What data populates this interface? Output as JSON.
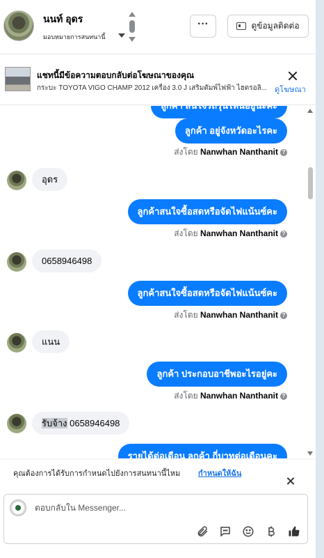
{
  "header": {
    "name": "นนท์ อุดร",
    "assign_label": "มอบหมายการสนทนานี้",
    "more_label": "···",
    "contact_label": "ดูข้อมูลติดต่อ"
  },
  "ad": {
    "title": "แชทนี้มีข้อความตอบกลับต่อโฆษณาของคุณ",
    "subtitle": "กระบะ TOYOTA VIGO CHAMP 2012 เครื่อง 3.0 J เสริมดัมพ์ไฟฟ้า ไฮดรอลิ...",
    "link": "ดูโฆษณา"
  },
  "messages": {
    "out_top_partial": "ลูกค้า สนใจรถรุ่นไหนอยู่นะคะ",
    "out_1": "ลูกค้า อยู่จังหวัดอะไรคะ",
    "in_1": "อุดร",
    "out_2": "ลูกค้าสนใจซื้อสดหรือจัดไฟแน้นซ์คะ",
    "in_2": "0658946498",
    "out_3": "ลูกค้าสนใจซื้อสดหรือจัดไฟแน้นซ์คะ",
    "in_3": "แนน",
    "out_4": "ลูกค้า ประกอบอาชีพอะไรอยู่คะ",
    "in_4_highlight": "รับจ้าง",
    "in_4_rest": " 0658946498",
    "out_bottom_partial": "รายได้ต่อเดือน ลูกค้า กี่บาทต่อเดือนคะ",
    "sent_by_prefix": "ส่งโดย",
    "sent_by_name": "Nanwhan Nanthanit"
  },
  "notice": {
    "text": "คุณต้องการได้รับการกำหนดไปยังการสนทนานี้ไหม",
    "link": "กำหนดให้ฉัน"
  },
  "composer": {
    "placeholder": "ตอบกลับใน Messenger..."
  },
  "icons": {
    "attach": "paperclip-icon",
    "saved_replies": "chat-bubble-icon",
    "emoji": "smiley-icon",
    "payment": "baht-icon",
    "like": "thumbs-up-icon"
  },
  "colors": {
    "outgoing_bubble": "#0a7cff",
    "incoming_bubble": "#f0f2f5",
    "link": "#1a73e8"
  }
}
